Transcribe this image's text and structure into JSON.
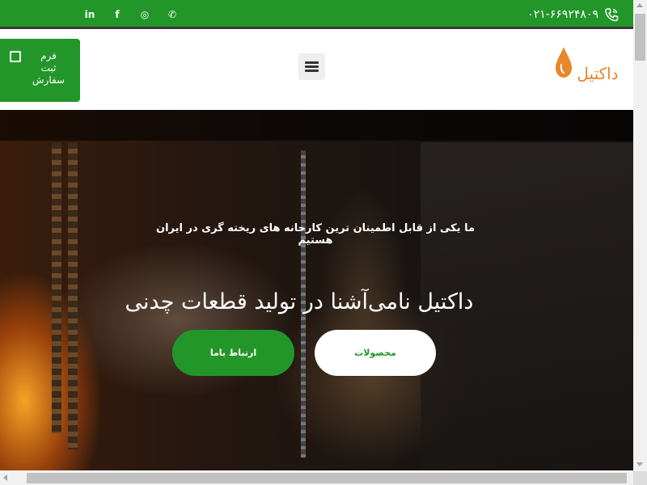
{
  "topbar": {
    "phone": "۰۲۱-۶۶۹۲۴۸۰۹",
    "phone_icon": "phone-icon",
    "social": [
      {
        "icon": "linkedin-icon",
        "glyph": "in"
      },
      {
        "icon": "facebook-icon",
        "glyph": "f"
      },
      {
        "icon": "instagram-icon",
        "glyph": "◎"
      },
      {
        "icon": "whatsapp-icon",
        "glyph": "✆"
      }
    ],
    "accent": "#23962a"
  },
  "header": {
    "order_button": {
      "line1": "فرم",
      "line2": "ثبت",
      "line3": "سفارش",
      "icon": "note-icon"
    },
    "menu_icon": "hamburger-menu-icon",
    "logo": {
      "text": "داکتیل",
      "drop_color": "#e8862a"
    }
  },
  "hero": {
    "subtitle": "ما یکی از قابل اطمینان ترین کارخانه های ریخته گری در ایران هستیم",
    "title": "داکتیل نامی‌آشنا در تولید قطعات چدنی",
    "buttons": {
      "contact": "ارتباط باما",
      "products": "محصولات"
    }
  }
}
